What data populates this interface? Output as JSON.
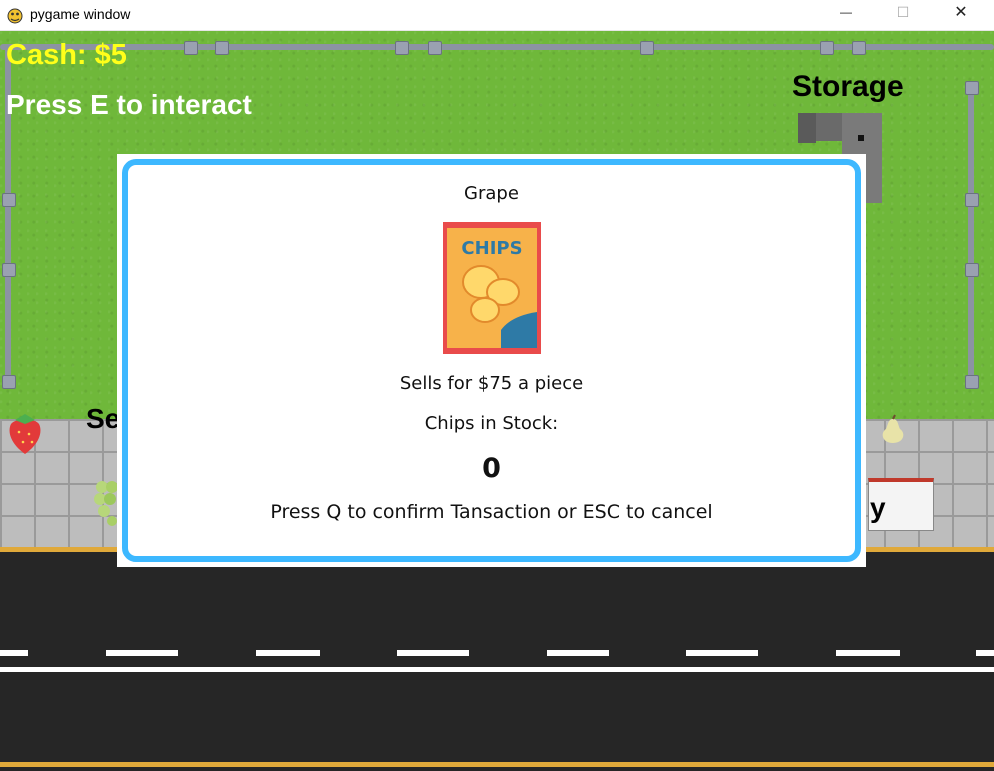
{
  "window": {
    "title": "pygame window",
    "minimize_symbol": "—",
    "maximize_symbol": "☐",
    "close_symbol": "✕"
  },
  "hud": {
    "cash": "Cash: $5",
    "interact_hint": "Press E to interact"
  },
  "world": {
    "storage_label": "Storage",
    "seller_label": "Se",
    "buy_label": "y",
    "produce_icons": [
      "strawberry-icon",
      "grape-icon",
      "pear-icon"
    ]
  },
  "dialog": {
    "title": "Grape",
    "product_art_text": "CHIPS",
    "price_line": "Sells for $75 a piece",
    "stock_label": "Chips in Stock:",
    "stock_count": "0",
    "instructions": "Press Q to confirm Tansaction or ESC to cancel"
  },
  "colors": {
    "grass": "#6fb83a",
    "cash_text": "#ffff1a",
    "dialog_border": "#3db8ff",
    "road": "#262626",
    "curb": "#e0a93a"
  }
}
